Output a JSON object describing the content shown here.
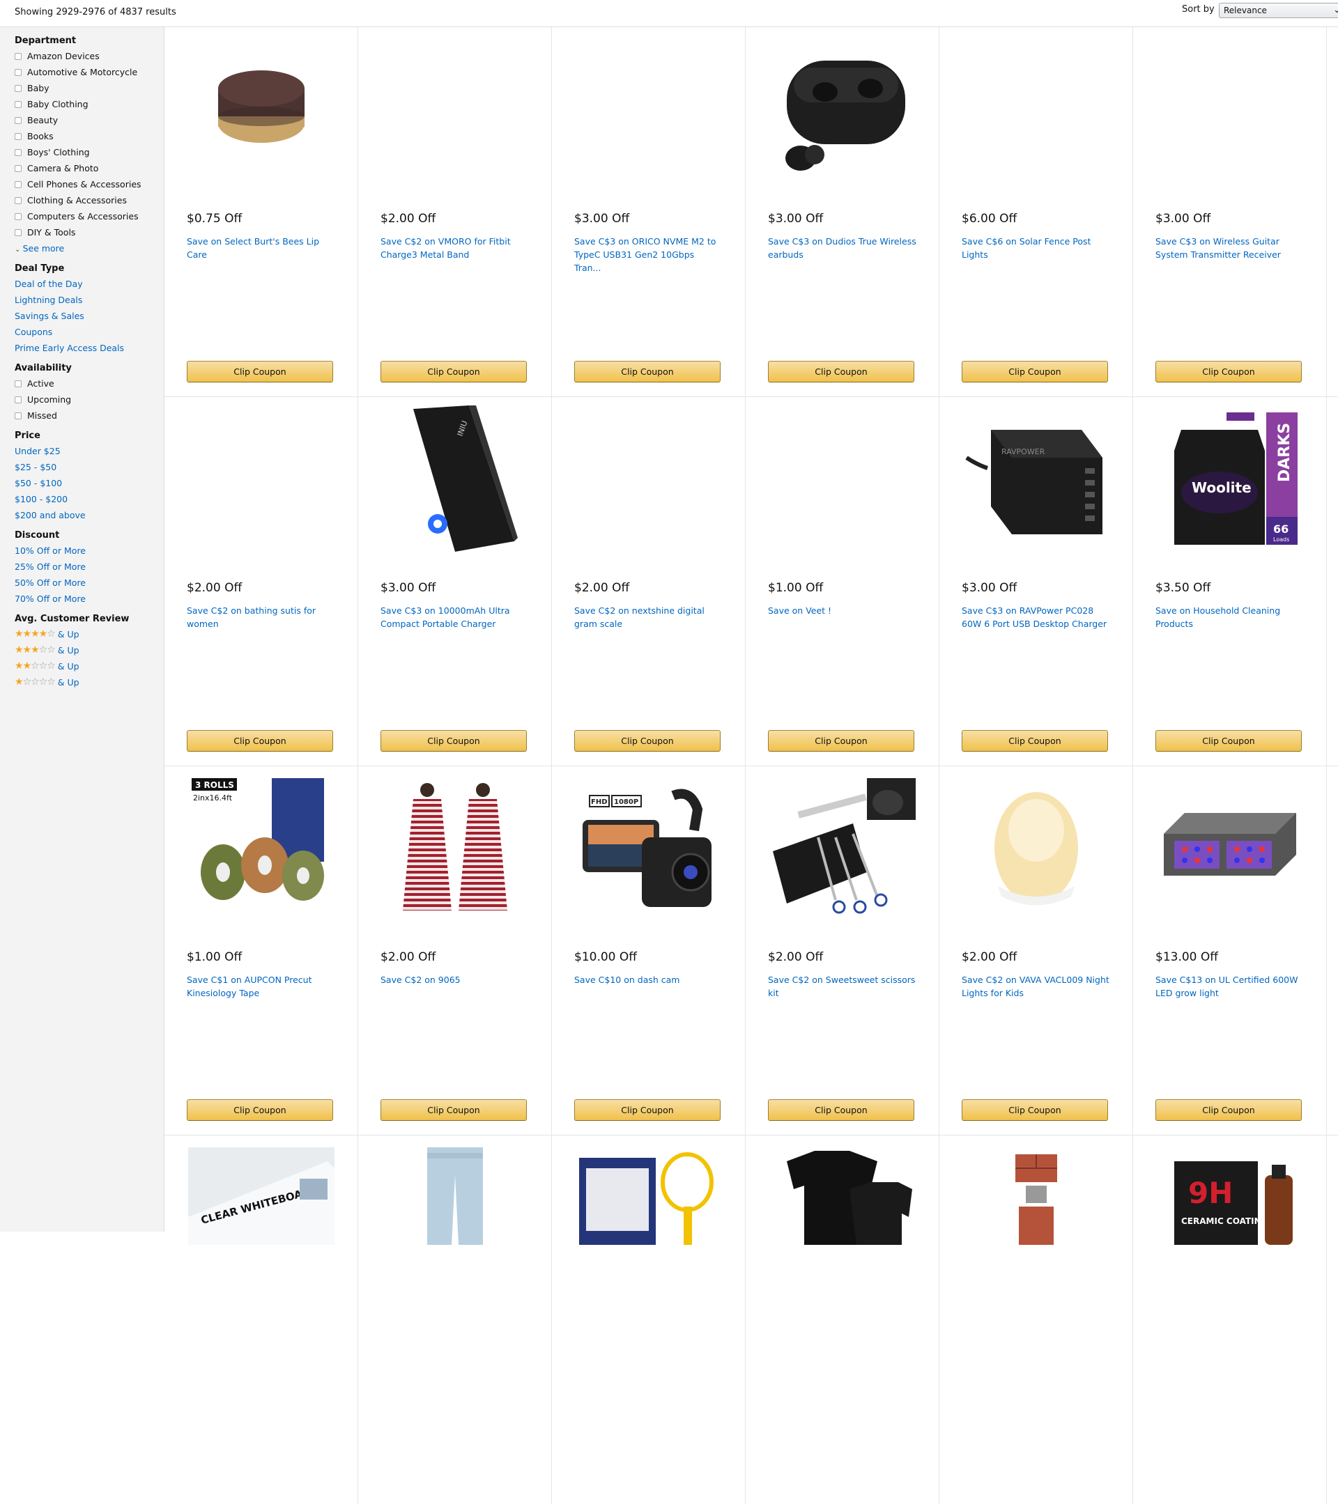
{
  "header": {
    "results_text": "Showing 2929-2976 of 4837 results",
    "sort_label": "Sort by",
    "sort_value": "Relevance"
  },
  "sidebar": {
    "department": {
      "title": "Department",
      "items": [
        "Amazon Devices",
        "Automotive & Motorcycle",
        "Baby",
        "Baby Clothing",
        "Beauty",
        "Books",
        "Boys' Clothing",
        "Camera & Photo",
        "Cell Phones & Accessories",
        "Clothing & Accessories",
        "Computers & Accessories",
        "DIY & Tools"
      ],
      "see_more": "See more"
    },
    "deal_type": {
      "title": "Deal Type",
      "items": [
        "Deal of the Day",
        "Lightning Deals",
        "Savings & Sales",
        "Coupons",
        "Prime Early Access Deals"
      ]
    },
    "availability": {
      "title": "Availability",
      "items": [
        "Active",
        "Upcoming",
        "Missed"
      ]
    },
    "price": {
      "title": "Price",
      "items": [
        "Under $25",
        "$25 - $50",
        "$50 - $100",
        "$100 - $200",
        "$200 and above"
      ]
    },
    "discount": {
      "title": "Discount",
      "items": [
        "10% Off or More",
        "25% Off or More",
        "50% Off or More",
        "70% Off or More"
      ]
    },
    "review": {
      "title": "Avg. Customer Review",
      "up_label": "& Up",
      "ratings": [
        4,
        3,
        2,
        1
      ]
    }
  },
  "products": [
    {
      "off": "$0.75 Off",
      "title": "Save on Select Burt's Bees Lip Care",
      "button": "Clip Coupon",
      "image": "lip-balm-jar"
    },
    {
      "off": "$2.00 Off",
      "title": "Save C$2 on VMORO for Fitbit Charge3 Metal Band",
      "button": "Clip Coupon",
      "image": ""
    },
    {
      "off": "$3.00 Off",
      "title": "Save C$3 on ORICO NVME M2 to TypeC USB31 Gen2 10Gbps Tran...",
      "button": "Clip Coupon",
      "image": ""
    },
    {
      "off": "$3.00 Off",
      "title": "Save C$3 on Dudios True Wireless earbuds",
      "button": "Clip Coupon",
      "image": "earbuds-case"
    },
    {
      "off": "$6.00 Off",
      "title": "Save C$6 on Solar Fence Post Lights",
      "button": "Clip Coupon",
      "image": ""
    },
    {
      "off": "$3.00 Off",
      "title": "Save C$3 on Wireless Guitar System Transmitter Receiver",
      "button": "Clip Coupon",
      "image": ""
    },
    {
      "off": "$2.00 Off",
      "title": "Save C$2 on bathing sutis for women",
      "button": "Clip Coupon",
      "image": ""
    },
    {
      "off": "$3.00 Off",
      "title": "Save C$3 on 10000mAh Ultra Compact Portable Charger",
      "button": "Clip Coupon",
      "image": "power-bank"
    },
    {
      "off": "$2.00 Off",
      "title": "Save C$2 on nextshine digital gram scale",
      "button": "Clip Coupon",
      "image": ""
    },
    {
      "off": "$1.00 Off",
      "title": "Save on Veet !",
      "button": "Clip Coupon",
      "image": ""
    },
    {
      "off": "$3.00 Off",
      "title": "Save C$3 on RAVPower PC028 60W 6 Port USB Desktop Charger",
      "button": "Clip Coupon",
      "image": "usb-charger"
    },
    {
      "off": "$3.50 Off",
      "title": "Save on Household Cleaning Products",
      "button": "Clip Coupon",
      "image": "detergent-bottle"
    },
    {
      "off": "$1.00 Off",
      "title": "Save C$1 on AUPCON Precut Kinesiology Tape",
      "button": "Clip Coupon",
      "image": "kinesiology-tape"
    },
    {
      "off": "$2.00 Off",
      "title": "Save C$2 on 9065",
      "button": "Clip Coupon",
      "image": "dresses"
    },
    {
      "off": "$10.00 Off",
      "title": "Save C$10 on dash cam",
      "button": "Clip Coupon",
      "image": "dash-cam"
    },
    {
      "off": "$2.00 Off",
      "title": "Save C$2 on Sweetsweet scissors kit",
      "button": "Clip Coupon",
      "image": "scissors-kit"
    },
    {
      "off": "$2.00 Off",
      "title": "Save C$2 on VAVA VACL009 Night Lights for Kids",
      "button": "Clip Coupon",
      "image": "night-light"
    },
    {
      "off": "$13.00 Off",
      "title": "Save C$13 on UL Certified 600W LED grow light",
      "button": "Clip Coupon",
      "image": "grow-light"
    },
    {
      "off": "",
      "title": "",
      "button": "",
      "image": "whiteboard-roll"
    },
    {
      "off": "",
      "title": "",
      "button": "",
      "image": "jeans"
    },
    {
      "off": "",
      "title": "",
      "button": "",
      "image": "bug-zapper"
    },
    {
      "off": "",
      "title": "",
      "button": "",
      "image": "black-shirts"
    },
    {
      "off": "",
      "title": "",
      "button": "",
      "image": "brick-usb"
    },
    {
      "off": "",
      "title": "",
      "button": "",
      "image": "ceramic-coating"
    }
  ],
  "image_text": {
    "tape_rolls": "3 ROLLS",
    "tape_size": "2inx16.4ft",
    "dashcam_fhd": "FHD",
    "dashcam_res": "1080P",
    "whiteboard": "CLEAR WHITEBOARD",
    "coating_9h": "9H",
    "coating_label": "CERAMIC COATING",
    "detergent_brand": "Woolite",
    "detergent_darks": "DARKS",
    "detergent_loads": "66",
    "detergent_loads_label": "Loads",
    "charger_brand": "RAVPOWER",
    "bank_brand": "INIU"
  }
}
